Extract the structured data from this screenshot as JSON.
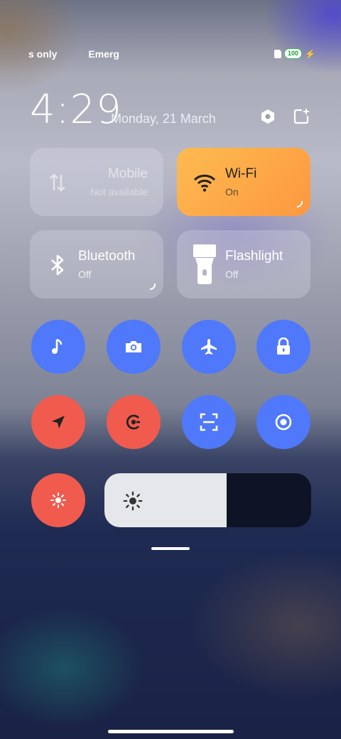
{
  "status_bar": {
    "left_texts": [
      "s only",
      "Emerg"
    ],
    "battery_level": "100"
  },
  "header": {
    "time": "4:29",
    "date": "Monday, 21 March",
    "settings_icon": "hexagon-settings-icon",
    "edit_icon": "edit-tiles-icon"
  },
  "tiles": {
    "mobile": {
      "title": "Mobile",
      "status": "Not available",
      "icon": "mobile-data-arrows-icon",
      "enabled": false
    },
    "wifi": {
      "title": "Wi-Fi",
      "status": "On",
      "icon": "wifi-icon",
      "color": "#fd9f45"
    },
    "bluetooth": {
      "title": "Bluetooth",
      "status": "Off",
      "icon": "bluetooth-icon"
    },
    "flashlight": {
      "title": "Flashlight",
      "status": "Off",
      "icon": "flashlight-icon"
    }
  },
  "toggles_row1": [
    {
      "icon": "music-note-icon",
      "color": "#4f78fb"
    },
    {
      "icon": "camera-icon",
      "color": "#4f78fb"
    },
    {
      "icon": "airplane-icon",
      "color": "#4f78fb"
    },
    {
      "icon": "lock-icon",
      "color": "#4f78fb"
    }
  ],
  "toggles_row2": [
    {
      "icon": "location-arrow-icon",
      "color": "#f15b4e"
    },
    {
      "icon": "auto-rotate-icon",
      "color": "#f15b4e"
    },
    {
      "icon": "scan-icon",
      "color": "#4f78fb"
    },
    {
      "icon": "screen-record-icon",
      "color": "#4f78fb"
    }
  ],
  "brightness": {
    "auto_icon": "auto-brightness-icon",
    "slider_icon": "brightness-sun-icon",
    "level": 0.59
  }
}
